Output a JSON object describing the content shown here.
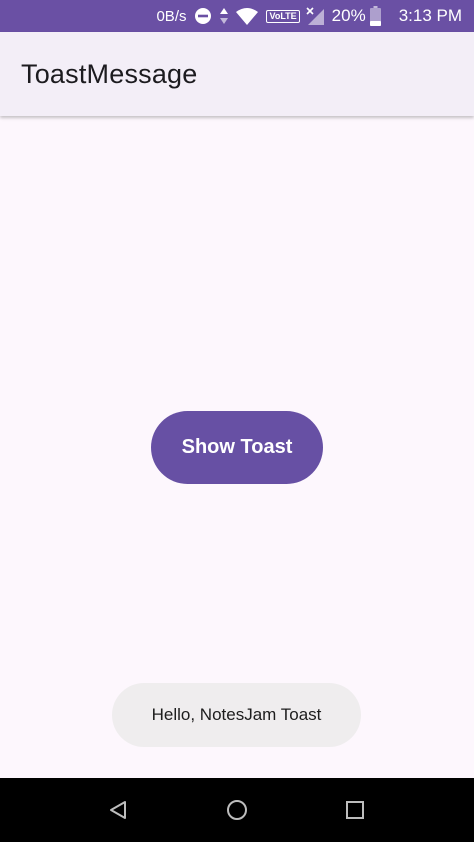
{
  "status_bar": {
    "net_speed": "0B/s",
    "volte_label": "VoLTE",
    "battery_percent": "20%",
    "time": "3:13 PM",
    "icons": [
      "do-not-disturb-icon",
      "data-arrows-icon",
      "wifi-icon",
      "volte-icon",
      "signal-icon",
      "battery-icon"
    ]
  },
  "app_bar": {
    "title": "ToastMessage"
  },
  "main": {
    "show_toast_label": "Show Toast"
  },
  "toast": {
    "message": "Hello, NotesJam Toast"
  },
  "nav_bar": {
    "icons": [
      "back-icon",
      "home-icon",
      "recents-icon"
    ]
  },
  "colors": {
    "status_bar": "#6a50a4",
    "app_bar": "#f3eef7",
    "background": "#fdf7fd",
    "accent": "#6750a4",
    "toast_bg": "#efedee",
    "nav_bar": "#000000"
  }
}
